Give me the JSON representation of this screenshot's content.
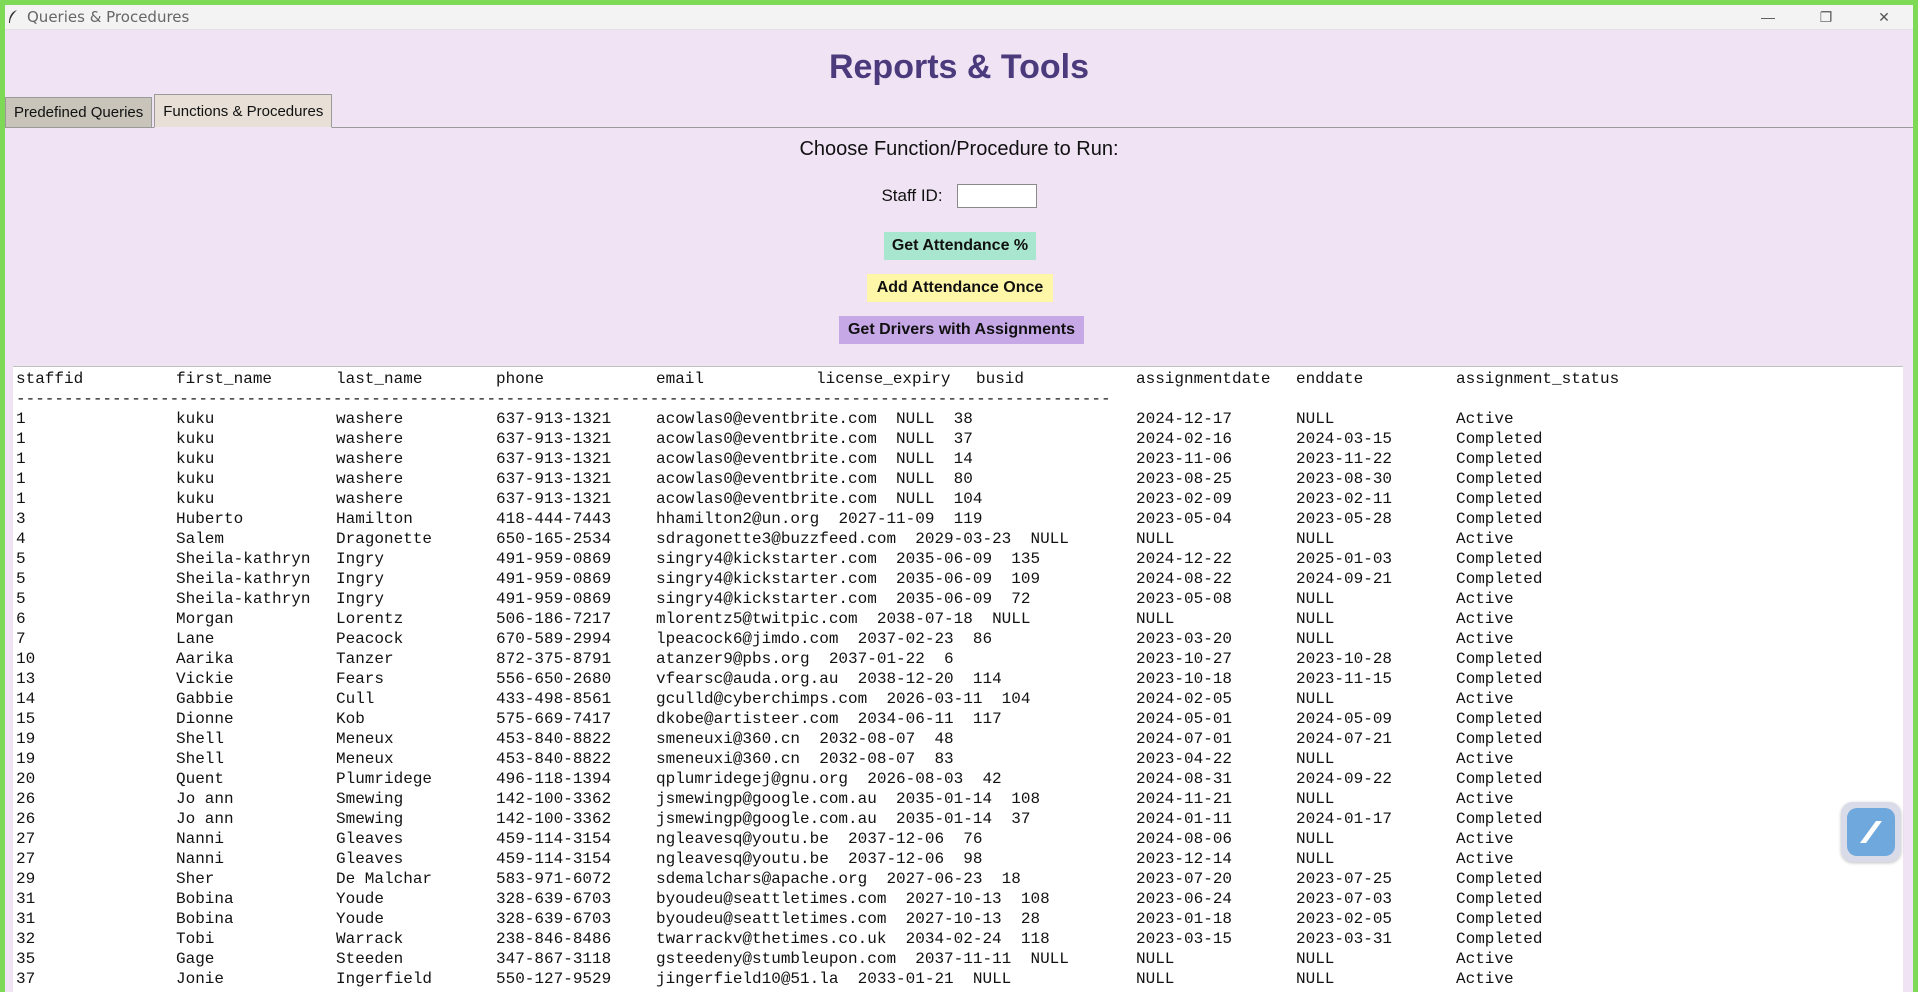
{
  "window": {
    "title": "Queries & Procedures",
    "controls": {
      "minimize": "—",
      "restore": "❐",
      "close": "✕"
    }
  },
  "header": {
    "title": "Reports & Tools"
  },
  "tabs": [
    {
      "label": "Predefined Queries",
      "active": false
    },
    {
      "label": "Functions & Procedures",
      "active": true
    }
  ],
  "panel": {
    "choose_label": "Choose Function/Procedure to Run:",
    "staff_id_label": "Staff ID:",
    "staff_id_value": "",
    "buttons": {
      "attendance": "Get Attendance %",
      "add_attendance": "Add Attendance Once",
      "drivers": "Get Drivers with Assignments"
    }
  },
  "output": {
    "headers": [
      "staffid",
      "first_name",
      "last_name",
      "phone",
      "email",
      "license_expiry",
      "busid",
      "assignmentdate",
      "enddate",
      "assignment_status"
    ],
    "separator": "------------------------------------------------------------------------------------------------------------------",
    "rows": [
      [
        "1",
        "kuku",
        "washere",
        "637-913-1321",
        "acowlas0@eventbrite.com",
        "NULL",
        "38",
        "2024-12-17",
        "NULL",
        "Active"
      ],
      [
        "1",
        "kuku",
        "washere",
        "637-913-1321",
        "acowlas0@eventbrite.com",
        "NULL",
        "37",
        "2024-02-16",
        "2024-03-15",
        "Completed"
      ],
      [
        "1",
        "kuku",
        "washere",
        "637-913-1321",
        "acowlas0@eventbrite.com",
        "NULL",
        "14",
        "2023-11-06",
        "2023-11-22",
        "Completed"
      ],
      [
        "1",
        "kuku",
        "washere",
        "637-913-1321",
        "acowlas0@eventbrite.com",
        "NULL",
        "80",
        "2023-08-25",
        "2023-08-30",
        "Completed"
      ],
      [
        "1",
        "kuku",
        "washere",
        "637-913-1321",
        "acowlas0@eventbrite.com",
        "NULL",
        "104",
        "2023-02-09",
        "2023-02-11",
        "Completed"
      ],
      [
        "3",
        "Huberto",
        "Hamilton",
        "418-444-7443",
        "hhamilton2@un.org",
        "2027-11-09",
        "119",
        "2023-05-04",
        "2023-05-28",
        "Completed"
      ],
      [
        "4",
        "Salem",
        "Dragonette",
        "650-165-2534",
        "sdragonette3@buzzfeed.com",
        "2029-03-23",
        "NULL",
        "NULL",
        "NULL",
        "Active"
      ],
      [
        "5",
        "Sheila-kathryn",
        "Ingry",
        "491-959-0869",
        "singry4@kickstarter.com",
        "2035-06-09",
        "135",
        "2024-12-22",
        "2025-01-03",
        "Completed"
      ],
      [
        "5",
        "Sheila-kathryn",
        "Ingry",
        "491-959-0869",
        "singry4@kickstarter.com",
        "2035-06-09",
        "109",
        "2024-08-22",
        "2024-09-21",
        "Completed"
      ],
      [
        "5",
        "Sheila-kathryn",
        "Ingry",
        "491-959-0869",
        "singry4@kickstarter.com",
        "2035-06-09",
        "72",
        "2023-05-08",
        "NULL",
        "Active"
      ],
      [
        "6",
        "Morgan",
        "Lorentz",
        "506-186-7217",
        "mlorentz5@twitpic.com",
        "2038-07-18",
        "NULL",
        "NULL",
        "NULL",
        "Active"
      ],
      [
        "7",
        "Lane",
        "Peacock",
        "670-589-2994",
        "lpeacock6@jimdo.com",
        "2037-02-23",
        "86",
        "2023-03-20",
        "NULL",
        "Active"
      ],
      [
        "10",
        "Aarika",
        "Tanzer",
        "872-375-8791",
        "atanzer9@pbs.org",
        "2037-01-22",
        "6",
        "2023-10-27",
        "2023-10-28",
        "Completed"
      ],
      [
        "13",
        "Vickie",
        "Fears",
        "556-650-2680",
        "vfearsc@auda.org.au",
        "2038-12-20",
        "114",
        "2023-10-18",
        "2023-11-15",
        "Completed"
      ],
      [
        "14",
        "Gabbie",
        "Cull",
        "433-498-8561",
        "gculld@cyberchimps.com",
        "2026-03-11",
        "104",
        "2024-02-05",
        "NULL",
        "Active"
      ],
      [
        "15",
        "Dionne",
        "Kob",
        "575-669-7417",
        "dkobe@artisteer.com",
        "2034-06-11",
        "117",
        "2024-05-01",
        "2024-05-09",
        "Completed"
      ],
      [
        "19",
        "Shell",
        "Meneux",
        "453-840-8822",
        "smeneuxi@360.cn",
        "2032-08-07",
        "48",
        "2024-07-01",
        "2024-07-21",
        "Completed"
      ],
      [
        "19",
        "Shell",
        "Meneux",
        "453-840-8822",
        "smeneuxi@360.cn",
        "2032-08-07",
        "83",
        "2023-04-22",
        "NULL",
        "Active"
      ],
      [
        "20",
        "Quent",
        "Plumridege",
        "496-118-1394",
        "qplumridegej@gnu.org",
        "2026-08-03",
        "42",
        "2024-08-31",
        "2024-09-22",
        "Completed"
      ],
      [
        "26",
        "Jo ann",
        "Smewing",
        "142-100-3362",
        "jsmewingp@google.com.au",
        "2035-01-14",
        "108",
        "2024-11-21",
        "NULL",
        "Active"
      ],
      [
        "26",
        "Jo ann",
        "Smewing",
        "142-100-3362",
        "jsmewingp@google.com.au",
        "2035-01-14",
        "37",
        "2024-01-11",
        "2024-01-17",
        "Completed"
      ],
      [
        "27",
        "Nanni",
        "Gleaves",
        "459-114-3154",
        "ngleavesq@youtu.be",
        "2037-12-06",
        "76",
        "2024-08-06",
        "NULL",
        "Active"
      ],
      [
        "27",
        "Nanni",
        "Gleaves",
        "459-114-3154",
        "ngleavesq@youtu.be",
        "2037-12-06",
        "98",
        "2023-12-14",
        "NULL",
        "Active"
      ],
      [
        "29",
        "Sher",
        "De Malchar",
        "583-971-6072",
        "sdemalchars@apache.org",
        "2027-06-23",
        "18",
        "2023-07-20",
        "2023-07-25",
        "Completed"
      ],
      [
        "31",
        "Bobina",
        "Youde",
        "328-639-6703",
        "byoudeu@seattletimes.com",
        "2027-10-13",
        "108",
        "2023-06-24",
        "2023-07-03",
        "Completed"
      ],
      [
        "31",
        "Bobina",
        "Youde",
        "328-639-6703",
        "byoudeu@seattletimes.com",
        "2027-10-13",
        "28",
        "2023-01-18",
        "2023-02-05",
        "Completed"
      ],
      [
        "32",
        "Tobi",
        "Warrack",
        "238-846-8486",
        "twarrackv@thetimes.co.uk",
        "2034-02-24",
        "118",
        "2023-03-15",
        "2023-03-31",
        "Completed"
      ],
      [
        "35",
        "Gage",
        "Steeden",
        "347-867-3118",
        "gsteedeny@stumbleupon.com",
        "2037-11-11",
        "NULL",
        "NULL",
        "NULL",
        "Active"
      ],
      [
        "37",
        "Jonie",
        "Ingerfield",
        "550-127-9529",
        "jingerfield10@51.la",
        "2033-01-21",
        "NULL",
        "NULL",
        "NULL",
        "Active"
      ]
    ]
  },
  "colors": {
    "title": "#4b3a7c",
    "panel_bg": "#efe3f4",
    "btn_attendance": "#a8e6cf",
    "btn_add": "#fff7a8",
    "btn_drivers": "#c7a8e6"
  }
}
